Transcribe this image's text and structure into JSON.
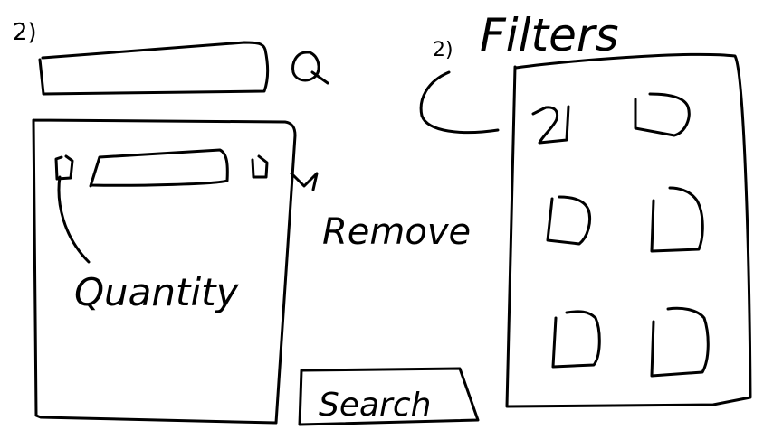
{
  "search": {
    "step_label": "2)",
    "query": "",
    "search_icon": "search-icon",
    "button_label": "Search"
  },
  "item_list": {
    "quantity_label": "Quantity",
    "remove_label": "Remove",
    "remove_arrow": "arrow-icon",
    "item_checkbox": "checkbox-icon"
  },
  "filters": {
    "step_label": "2)",
    "title": "Filters",
    "arrow_icon": "curved-arrow-icon",
    "checkboxes": [
      {
        "checked": true
      },
      {
        "checked": false
      },
      {
        "checked": false
      },
      {
        "checked": false
      },
      {
        "checked": false
      },
      {
        "checked": false
      }
    ]
  }
}
